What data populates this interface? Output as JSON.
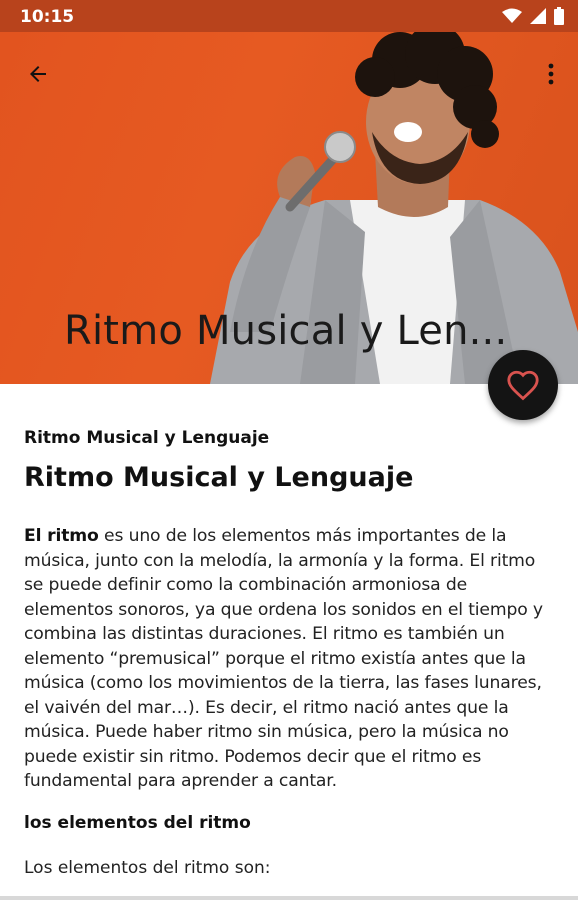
{
  "status_bar": {
    "time": "10:15"
  },
  "header": {
    "title": "Ritmo Musical y Len..."
  },
  "article": {
    "subtitle": "Ritmo Musical y Lenguaje",
    "title": "Ritmo Musical y Lenguaje",
    "paragraph_lead": "El ritmo",
    "paragraph_body": "  es uno de los elementos más importantes de la música, junto con la melodía, la armonía y la forma. El ritmo se puede definir como la combinación armoniosa de elementos sonoros, ya que ordena los sonidos en el tiempo y combina las distintas duraciones. El ritmo es también un elemento “premusical” porque el ritmo existía antes que la música (como los movimientos de la tierra, las fases lunares, el vaivén del mar…). Es decir, el ritmo nació antes que la música. Puede haber ritmo sin música, pero la música no puede existir sin ritmo. Podemos decir que el ritmo es fundamental para aprender a cantar.",
    "section_heading": "los elementos del ritmo",
    "section_text": "Los elementos del ritmo son:"
  },
  "colors": {
    "header_bg": "#e2541f",
    "status_bar_bg": "#b8431c",
    "fab_bg": "#141414",
    "heart": "#d9534f"
  },
  "icons": {
    "back": "arrow-left-icon",
    "menu": "more-vert-icon",
    "favorite": "heart-outline-icon",
    "wifi": "wifi-icon",
    "signal": "signal-icon",
    "battery": "battery-icon"
  }
}
